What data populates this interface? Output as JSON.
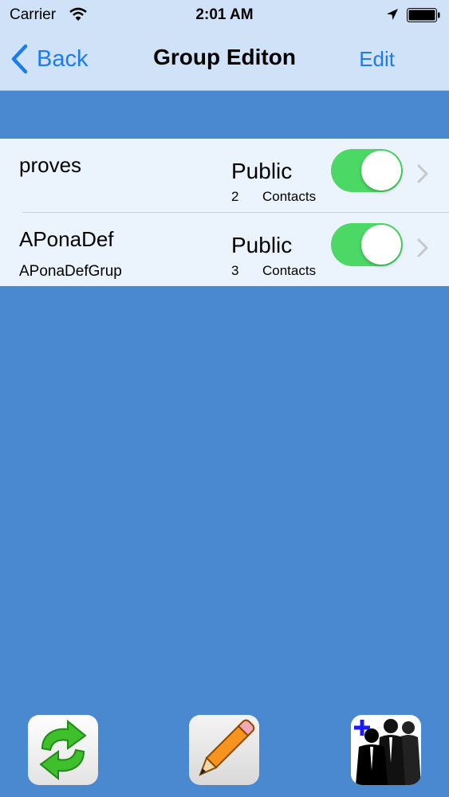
{
  "status_bar": {
    "carrier": "Carrier",
    "time": "2:01 AM"
  },
  "nav": {
    "back_label": "Back",
    "title": "Group Editon",
    "edit_label": "Edit"
  },
  "groups": [
    {
      "name": "proves",
      "subtitle": "",
      "visibility": "Public",
      "count": "2",
      "contacts_label": "Contacts",
      "enabled": true
    },
    {
      "name": "APonaDef",
      "subtitle": "APonaDefGrup",
      "visibility": "Public",
      "count": "3",
      "contacts_label": "Contacts",
      "enabled": true
    }
  ],
  "toolbar": {
    "icons": [
      "refresh-icon",
      "pencil-icon",
      "add-group-icon"
    ]
  },
  "colors": {
    "background": "#4a89d0",
    "nav_bar": "#cfe2f8",
    "tint": "#1b7cf0",
    "toggle_on": "#4cd864"
  }
}
